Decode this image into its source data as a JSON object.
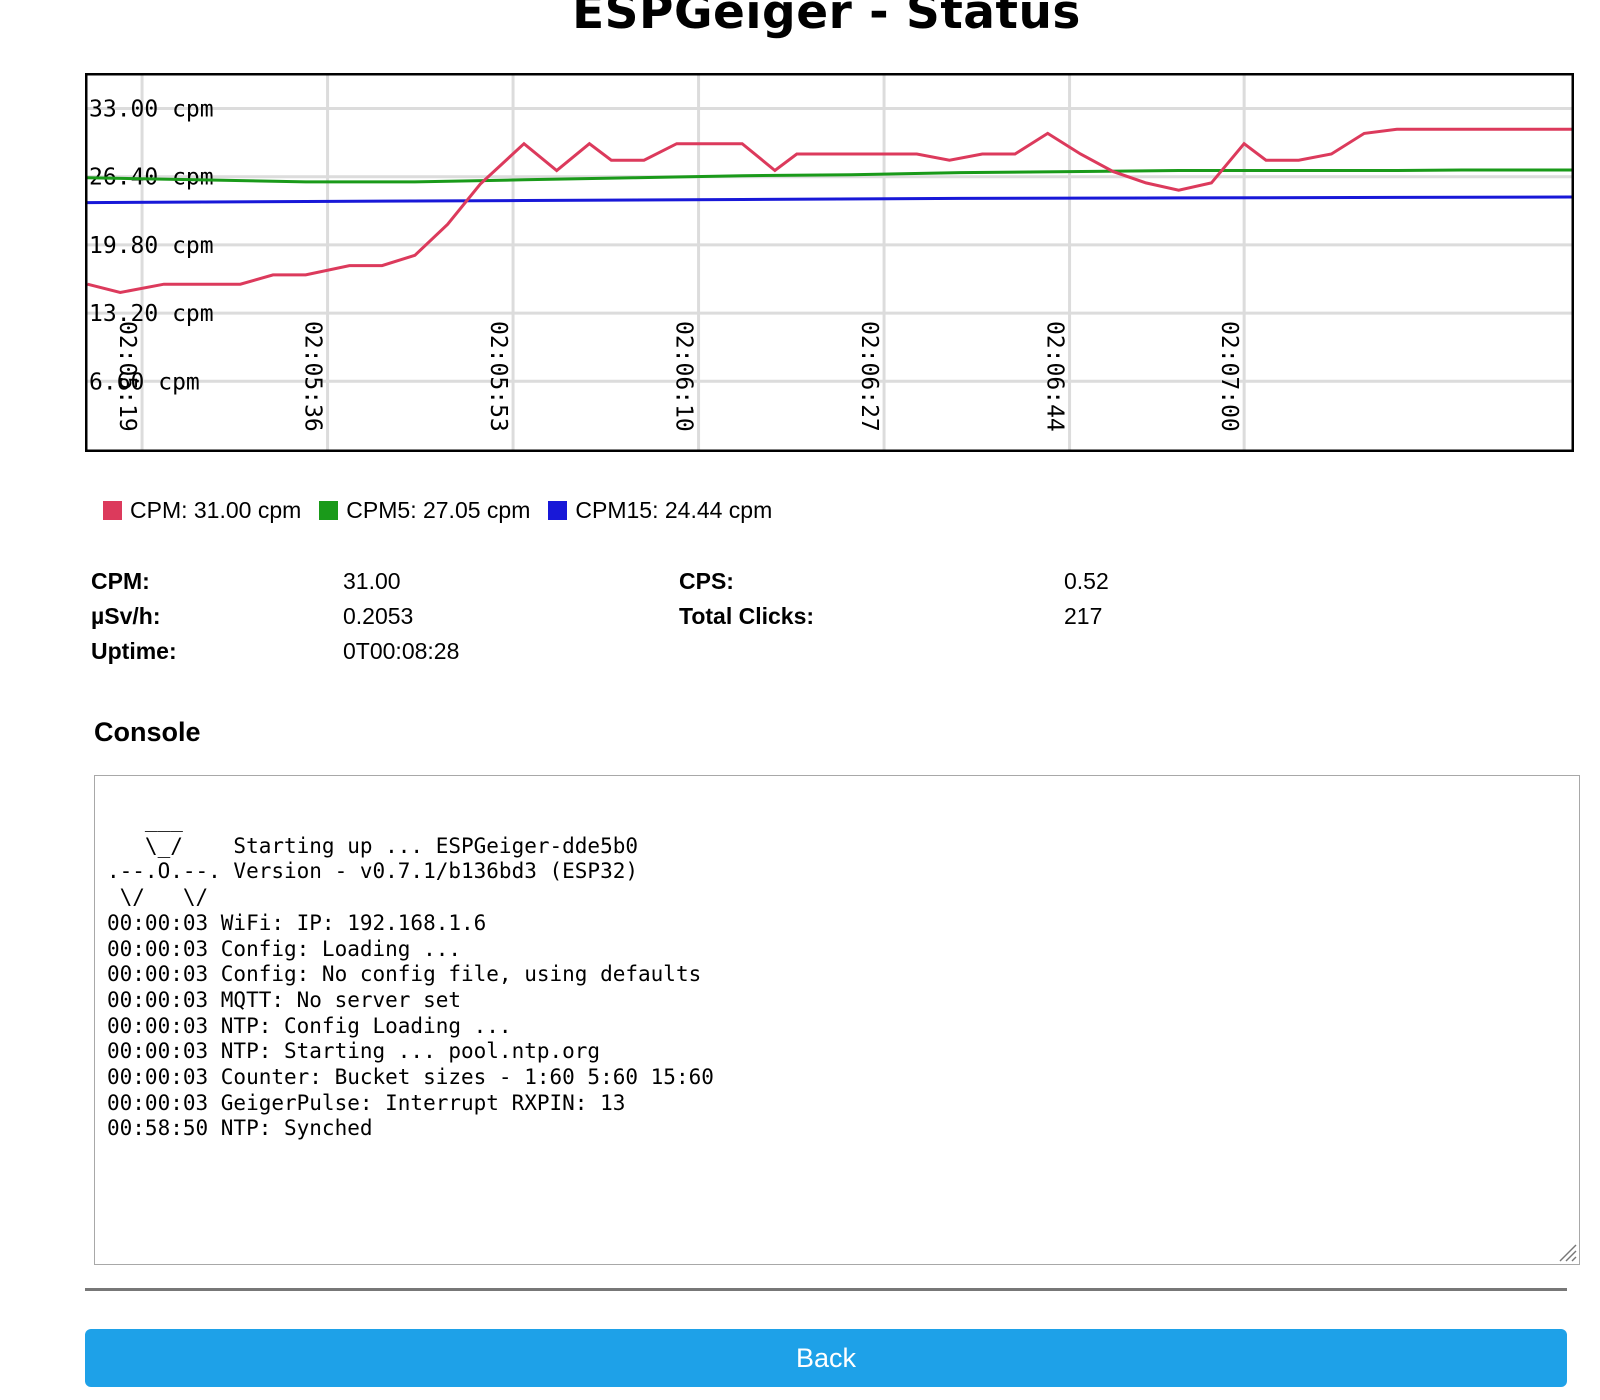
{
  "page": {
    "title": "ESPGeiger - Status"
  },
  "chart_data": {
    "type": "line",
    "y_tick_labels": [
      "33.00 cpm",
      "26.40 cpm",
      "19.80 cpm",
      "13.20 cpm",
      "6.60 cpm"
    ],
    "y_ticks": [
      33,
      26.4,
      19.8,
      13.2,
      6.6
    ],
    "ylim": [
      0,
      36.2
    ],
    "x_tick_labels": [
      "02:05:19",
      "02:05:36",
      "02:05:53",
      "02:06:10",
      "02:06:27",
      "02:06:44",
      "02:07:00"
    ],
    "x_ticks": [
      5,
      22,
      39,
      56,
      73,
      90,
      106
    ],
    "xlim": [
      0,
      136
    ],
    "grid": true,
    "series": [
      {
        "name": "CPM",
        "color": "#dc3a5c",
        "x": [
          0,
          3,
          7,
          14,
          17,
          20,
          24,
          27,
          30,
          33,
          36,
          40,
          43,
          46,
          48,
          51,
          54,
          57,
          60,
          63,
          65,
          68,
          70,
          73,
          76,
          79,
          82,
          85,
          88,
          91,
          94,
          97,
          100,
          103,
          106,
          108,
          111,
          114,
          117,
          120,
          124,
          127,
          130,
          133,
          136
        ],
        "y": [
          16,
          15.2,
          16,
          16,
          16.9,
          16.9,
          17.8,
          17.8,
          18.8,
          21.8,
          25.7,
          29.6,
          27,
          29.6,
          28,
          28,
          29.6,
          29.6,
          29.6,
          27,
          28.6,
          28.6,
          28.6,
          28.6,
          28.6,
          28,
          28.6,
          28.6,
          30.6,
          28.6,
          26.9,
          25.8,
          25.1,
          25.8,
          29.6,
          28,
          28,
          28.6,
          30.6,
          31,
          31,
          31,
          31,
          31,
          31
        ]
      },
      {
        "name": "CPM5",
        "color": "#1a9a1a",
        "x": [
          0,
          10,
          20,
          30,
          40,
          50,
          60,
          70,
          80,
          90,
          100,
          110,
          120,
          126,
          136
        ],
        "y": [
          26.3,
          26.1,
          25.9,
          25.9,
          26.1,
          26.3,
          26.5,
          26.6,
          26.8,
          26.9,
          27,
          27,
          27,
          27.05,
          27.05
        ]
      },
      {
        "name": "CPM15",
        "color": "#1818d8",
        "x": [
          0,
          20,
          40,
          60,
          80,
          100,
          120,
          136
        ],
        "y": [
          23.9,
          24,
          24.1,
          24.2,
          24.3,
          24.35,
          24.4,
          24.44
        ]
      }
    ]
  },
  "legend": [
    {
      "label": "CPM: 31.00 cpm",
      "color": "#dc3a5c"
    },
    {
      "label": "CPM5: 27.05 cpm",
      "color": "#1a9a1a"
    },
    {
      "label": "CPM15: 24.44 cpm",
      "color": "#1818d8"
    }
  ],
  "stats": {
    "cpm_label": "CPM:",
    "cpm_value": "31.00",
    "usvh_label": "µSv/h:",
    "usvh_value": "0.2053",
    "uptime_label": "Uptime:",
    "uptime_value": "0T00:08:28",
    "cps_label": "CPS:",
    "cps_value": "0.52",
    "clicks_label": "Total Clicks:",
    "clicks_value": "217"
  },
  "console": {
    "heading": "Console",
    "text": "   ___\n   \\_/    Starting up ... ESPGeiger-dde5b0\n.--.O.--. Version - v0.7.1/b136bd3 (ESP32)\n \\/   \\/\n00:00:03 WiFi: IP: 192.168.1.6\n00:00:03 Config: Loading ...\n00:00:03 Config: No config file, using defaults\n00:00:03 MQTT: No server set\n00:00:03 NTP: Config Loading ...\n00:00:03 NTP: Starting ... pool.ntp.org\n00:00:03 Counter: Bucket sizes - 1:60 5:60 15:60\n00:00:03 GeigerPulse: Interrupt RXPIN: 13\n00:58:50 NTP: Synched"
  },
  "buttons": {
    "back_label": "Back"
  }
}
